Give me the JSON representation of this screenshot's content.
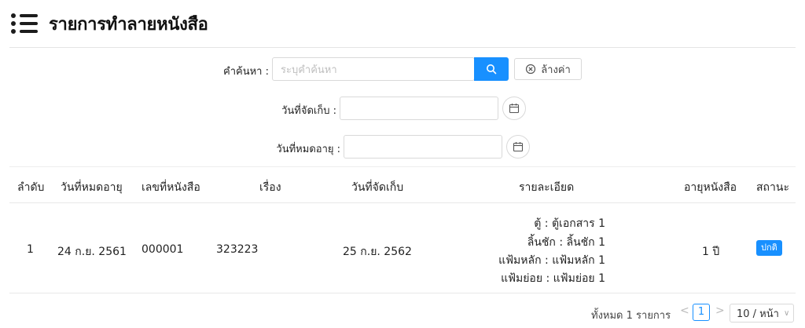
{
  "header": {
    "title": "รายการทำลายหนังสือ",
    "icon": "list-icon"
  },
  "search": {
    "label": "คำค้นหา :",
    "placeholder": "ระบุคำค้นหา",
    "search_icon": "search-icon",
    "clear_label": "ล้างค่า",
    "clear_icon": "close-circle-icon"
  },
  "filters": {
    "stored_date_label": "วันที่จัดเก็บ :",
    "expiry_date_label": "วันที่หมดอายุ :",
    "calendar_icon": "calendar-icon"
  },
  "table": {
    "columns": [
      "ลำดับ",
      "วันที่หมดอายุ",
      "เลขที่หนังสือ",
      "เรื่อง",
      "วันที่จัดเก็บ",
      "รายละเอียด",
      "อายุหนังสือ",
      "สถานะ"
    ],
    "rows": [
      {
        "index": "1",
        "expiry": "24 ก.ย. 2561",
        "number": "000001",
        "subject": "323223",
        "stored": "25 ก.ย. 2562",
        "details": [
          "ตู้ : ตู้เอกสาร 1",
          "ลิ้นชัก : ลิ้นชัก 1",
          "แฟ้มหลัก : แฟ้มหลัก 1",
          "แฟ้มย่อย : แฟ้มย่อย 1"
        ],
        "age": "1 ปี",
        "status": "ปกติ"
      }
    ]
  },
  "pagination": {
    "total": "ทั้งหมด 1 รายการ",
    "prev": "<",
    "current": "1",
    "next": ">",
    "page_size": "10 / หน้า"
  },
  "colors": {
    "primary": "#1890ff",
    "border": "#d9d9d9"
  }
}
